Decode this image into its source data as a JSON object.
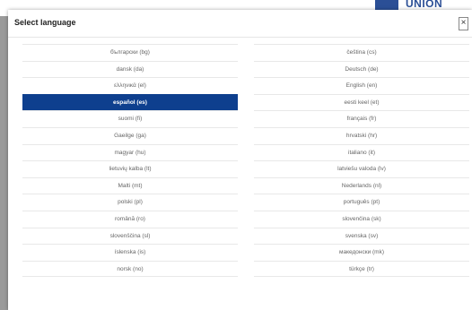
{
  "background": {
    "logo_text": "UNION"
  },
  "dialog": {
    "title": "Select language",
    "close_label": "×"
  },
  "languages_left": [
    {
      "label": "български (bg)"
    },
    {
      "label": "dansk (da)"
    },
    {
      "label": "ελληνικά (el)"
    },
    {
      "label": "español (es)",
      "selected": true
    },
    {
      "label": "suomi (fi)"
    },
    {
      "label": "Gaeilge (ga)"
    },
    {
      "label": "magyar (hu)"
    },
    {
      "label": "lietuvių kalba (lt)"
    },
    {
      "label": "Malti (mt)"
    },
    {
      "label": "polski (pl)"
    },
    {
      "label": "română (ro)"
    },
    {
      "label": "slovenščina (sl)"
    },
    {
      "label": "íslenska (is)"
    },
    {
      "label": "norsk (no)"
    }
  ],
  "languages_right": [
    {
      "label": "čeština (cs)"
    },
    {
      "label": "Deutsch (de)"
    },
    {
      "label": "English (en)"
    },
    {
      "label": "eesti keel (et)"
    },
    {
      "label": "français (fr)"
    },
    {
      "label": "hrvatski (hr)"
    },
    {
      "label": "italiano (it)"
    },
    {
      "label": "latviešu valoda (lv)"
    },
    {
      "label": "Nederlands (nl)"
    },
    {
      "label": "português (pt)"
    },
    {
      "label": "slovenčina (sk)"
    },
    {
      "label": "svenska (sv)"
    },
    {
      "label": "македонски (mk)"
    },
    {
      "label": "türkçe (tr)"
    }
  ],
  "colors": {
    "selected_bg": "#0e3f8e",
    "selected_text": "#ffffff",
    "overlay": "#9a9a9a"
  }
}
